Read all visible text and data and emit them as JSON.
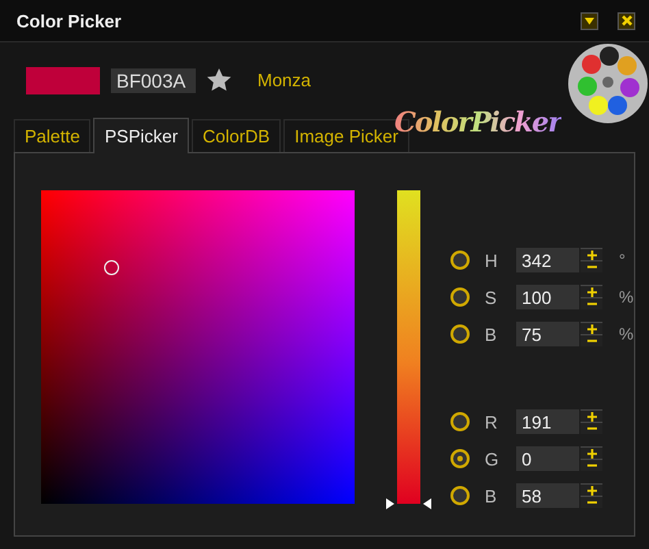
{
  "window": {
    "title": "Color Picker"
  },
  "current": {
    "hex": "BF003A",
    "favorite": false,
    "name": "Monza"
  },
  "logo_text": "ColorPicker",
  "tabs": [
    {
      "label": "Palette",
      "selected": false
    },
    {
      "label": "PSPicker",
      "selected": true
    },
    {
      "label": "ColorDB",
      "selected": false
    },
    {
      "label": "Image Picker",
      "selected": false
    }
  ],
  "slider": {
    "level": 0
  },
  "channels": [
    {
      "label": "H",
      "value": "342",
      "unit": "°",
      "selected": false
    },
    {
      "label": "S",
      "value": "100",
      "unit": "%",
      "selected": false
    },
    {
      "label": "B",
      "value": "75",
      "unit": "%",
      "selected": false
    },
    {
      "label": "R",
      "value": "191",
      "selected": false
    },
    {
      "label": "G",
      "value": "0",
      "selected": true
    },
    {
      "label": "B",
      "value": "58",
      "selected": false
    }
  ]
}
